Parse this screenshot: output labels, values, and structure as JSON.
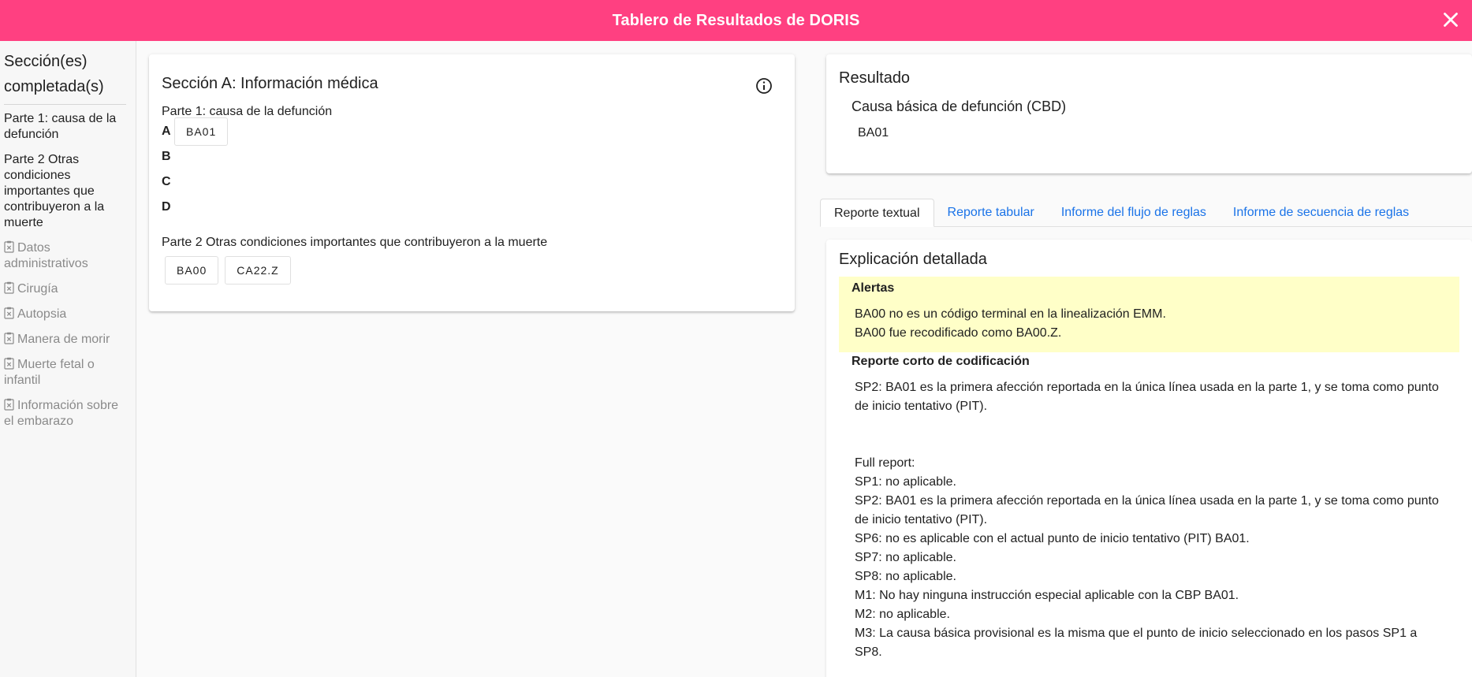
{
  "header": {
    "title": "Tablero de Resultados de DORIS"
  },
  "sidebar": {
    "heading": "Sección(es) completada(s)",
    "items": [
      {
        "label": "Parte 1: causa de la defunción",
        "enabled": true
      },
      {
        "label": "Parte 2 Otras condiciones importantes que contribuyeron a la muerte",
        "enabled": true
      },
      {
        "label": "Datos administrativos",
        "enabled": false,
        "icon": "clipboard-x-icon"
      },
      {
        "label": "Cirugía",
        "enabled": false,
        "icon": "clipboard-x-icon"
      },
      {
        "label": "Autopsia",
        "enabled": false,
        "icon": "clipboard-x-icon"
      },
      {
        "label": "Manera de morir",
        "enabled": false,
        "icon": "clipboard-x-icon"
      },
      {
        "label": "Muerte fetal o infantil",
        "enabled": false,
        "icon": "clipboard-x-icon"
      },
      {
        "label": "Información sobre el embarazo",
        "enabled": false,
        "icon": "clipboard-x-icon"
      }
    ]
  },
  "sectionA": {
    "title": "Sección A: Información médica",
    "part1_label": "Parte 1: causa de la defunción",
    "rows": [
      {
        "letter": "A",
        "codes": [
          "BA01"
        ]
      },
      {
        "letter": "B",
        "codes": []
      },
      {
        "letter": "C",
        "codes": []
      },
      {
        "letter": "D",
        "codes": []
      }
    ],
    "part2_label": "Parte 2 Otras condiciones importantes que contribuyeron a la muerte",
    "part2_codes": [
      "BA00",
      "CA22.Z"
    ]
  },
  "result": {
    "title": "Resultado",
    "cbd_label": "Causa básica de defunción (CBD)",
    "cbd_value": "BA01"
  },
  "tabs": [
    {
      "label": "Reporte textual",
      "active": true
    },
    {
      "label": "Reporte tabular",
      "active": false
    },
    {
      "label": "Informe del flujo de reglas",
      "active": false
    },
    {
      "label": "Informe de secuencia de reglas",
      "active": false
    }
  ],
  "detail": {
    "title": "Explicación detallada",
    "alerts_label": "Alertas",
    "alerts": [
      "BA00 no es un código terminal en la linealización EMM.",
      "BA00 fue recodificado como BA00.Z."
    ],
    "short_label": "Reporte corto de codificación",
    "short_text": "SP2: BA01 es la primera afección reportada en la única línea usada en la parte 1, y se toma como punto de inicio tentativo (PIT).",
    "full_lines": [
      "Full report:",
      "SP1: no aplicable.",
      "SP2: BA01 es la primera afección reportada en la única línea usada en la parte 1, y se toma como punto de inicio tentativo (PIT).",
      "SP6: no es aplicable con el actual punto de inicio tentativo (PIT) BA01.",
      "SP7: no aplicable.",
      "SP8: no aplicable.",
      "M1: No hay ninguna instrucción especial aplicable con la CBP BA01.",
      "M2: no aplicable.",
      "M3: La causa básica provisional es la misma que el punto de inicio seleccionado en los pasos SP1 a SP8."
    ]
  },
  "colors": {
    "header": "#ff4081",
    "link": "#1a73e8",
    "alert_bg": "#ffffc8"
  }
}
